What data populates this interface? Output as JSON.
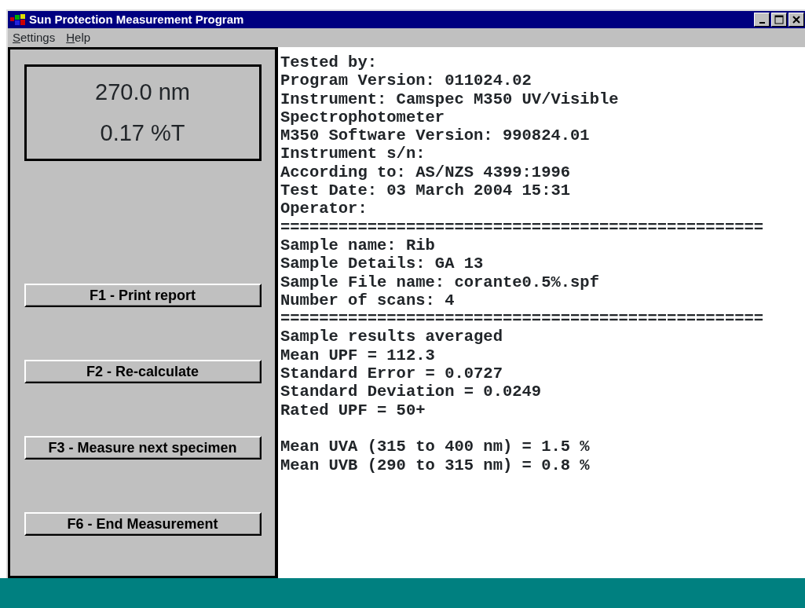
{
  "window": {
    "title": "Sun Protection Measurement Program"
  },
  "menu": [
    {
      "label": "Settings"
    },
    {
      "label": "Help"
    }
  ],
  "readout": {
    "wavelength": "270.0 nm",
    "transmission": "0.17 %T"
  },
  "buttons": [
    {
      "label": "F1 - Print report"
    },
    {
      "label": "F2 - Re-calculate"
    },
    {
      "label": "F3 - Measure next specimen"
    },
    {
      "label": "F6 - End Measurement"
    }
  ],
  "report": [
    {
      "lines": [
        "Tested by:",
        "Program Version: 011024.02",
        "Instrument: Camspec M350 UV/Visible",
        "Spectrophotometer",
        "M350 Software Version: 990824.01",
        "Instrument s/n:",
        "According to: AS/NZS 4399:1996",
        "Test Date: 03 March 2004 15:31",
        "Operator:"
      ]
    },
    {
      "separator": "==================================================",
      "lines": [
        "Sample name: Rib",
        "Sample Details: GA 13",
        "Sample File name: corante0.5%.spf",
        "Number of scans: 4"
      ]
    },
    {
      "separator": "==================================================",
      "lines": [
        "Sample results averaged",
        "Mean UPF = 112.3",
        "Standard Error = 0.0727",
        "Standard Deviation = 0.0249",
        "Rated UPF = 50+"
      ]
    },
    {
      "lines": [
        "Mean UVA (315 to 400 nm) = 1.5 %",
        "Mean UVB (290 to 315 nm) = 0.8 %"
      ]
    }
  ]
}
